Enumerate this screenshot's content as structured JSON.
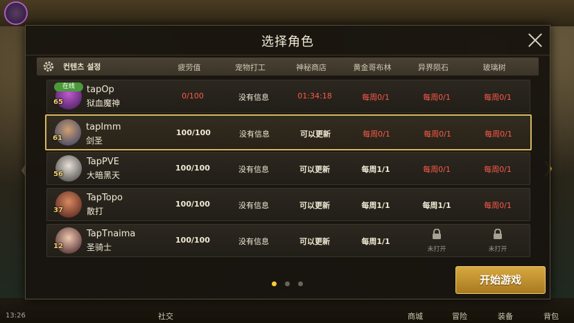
{
  "dialog": {
    "title": "选择角色",
    "start_button": "开始游戏"
  },
  "header": {
    "settings_label": "컨텐츠 설정",
    "columns": [
      "疲劳值",
      "宠物打工",
      "神秘商店",
      "黄金哥布林",
      "异界陨石",
      "玻璃树"
    ]
  },
  "characters": [
    {
      "name": "tapOp",
      "class": "狱血魔神",
      "level": "65",
      "online": "在线",
      "fatigue": "0/100",
      "pet": "没有信息",
      "shop": "01:34:18",
      "goblin": "每周0/1",
      "meteor": "每周0/1",
      "tree": "每周0/1"
    },
    {
      "name": "tapImm",
      "class": "剑圣",
      "level": "61",
      "fatigue": "100/100",
      "pet": "没有信息",
      "shop": "可以更新",
      "goblin": "每周0/1",
      "meteor": "每周0/1",
      "tree": "每周0/1"
    },
    {
      "name": "TapPVE",
      "class": "大暗黑天",
      "level": "56",
      "fatigue": "100/100",
      "pet": "没有信息",
      "shop": "可以更新",
      "goblin": "每周1/1",
      "meteor": "每周0/1",
      "tree": "每周0/1"
    },
    {
      "name": "TapTopo",
      "class": "散打",
      "level": "37",
      "fatigue": "100/100",
      "pet": "没有信息",
      "shop": "可以更新",
      "goblin": "每周1/1",
      "meteor": "每周1/1",
      "tree": "每周0/1"
    },
    {
      "name": "TapTnaima",
      "class": "圣骑士",
      "level": "12",
      "fatigue": "100/100",
      "pet": "没有信息",
      "shop": "可以更新",
      "goblin": "每周1/1",
      "meteor": "未打开",
      "tree": "未打开"
    }
  ],
  "statusbar": {
    "time": "13:26",
    "labels": [
      "社交",
      "商城",
      "冒险",
      "装备",
      "背包"
    ]
  },
  "pager": {
    "pages": 3,
    "active": 1
  },
  "colors": {
    "accent": "#d8b860",
    "warning": "#ff5a4a",
    "online": "#4a9a3a"
  }
}
